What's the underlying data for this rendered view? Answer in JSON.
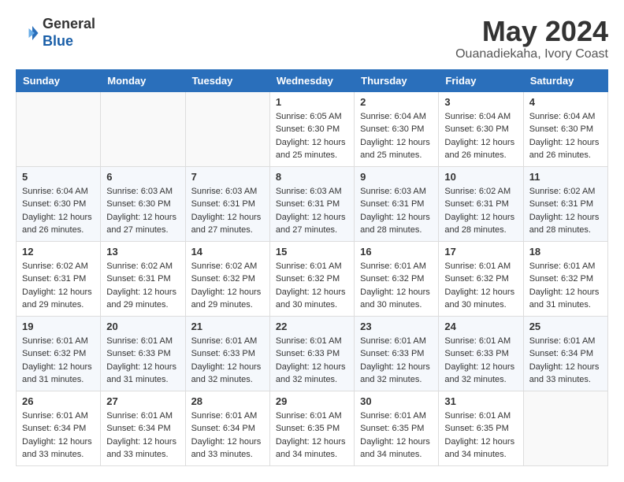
{
  "logo": {
    "line1": "General",
    "line2": "Blue"
  },
  "title": {
    "month_year": "May 2024",
    "location": "Ouanadiekaha, Ivory Coast"
  },
  "headers": [
    "Sunday",
    "Monday",
    "Tuesday",
    "Wednesday",
    "Thursday",
    "Friday",
    "Saturday"
  ],
  "weeks": [
    [
      {
        "day": "",
        "sunrise": "",
        "sunset": "",
        "daylight": ""
      },
      {
        "day": "",
        "sunrise": "",
        "sunset": "",
        "daylight": ""
      },
      {
        "day": "",
        "sunrise": "",
        "sunset": "",
        "daylight": ""
      },
      {
        "day": "1",
        "sunrise": "Sunrise: 6:05 AM",
        "sunset": "Sunset: 6:30 PM",
        "daylight": "Daylight: 12 hours and 25 minutes."
      },
      {
        "day": "2",
        "sunrise": "Sunrise: 6:04 AM",
        "sunset": "Sunset: 6:30 PM",
        "daylight": "Daylight: 12 hours and 25 minutes."
      },
      {
        "day": "3",
        "sunrise": "Sunrise: 6:04 AM",
        "sunset": "Sunset: 6:30 PM",
        "daylight": "Daylight: 12 hours and 26 minutes."
      },
      {
        "day": "4",
        "sunrise": "Sunrise: 6:04 AM",
        "sunset": "Sunset: 6:30 PM",
        "daylight": "Daylight: 12 hours and 26 minutes."
      }
    ],
    [
      {
        "day": "5",
        "sunrise": "Sunrise: 6:04 AM",
        "sunset": "Sunset: 6:30 PM",
        "daylight": "Daylight: 12 hours and 26 minutes."
      },
      {
        "day": "6",
        "sunrise": "Sunrise: 6:03 AM",
        "sunset": "Sunset: 6:30 PM",
        "daylight": "Daylight: 12 hours and 27 minutes."
      },
      {
        "day": "7",
        "sunrise": "Sunrise: 6:03 AM",
        "sunset": "Sunset: 6:31 PM",
        "daylight": "Daylight: 12 hours and 27 minutes."
      },
      {
        "day": "8",
        "sunrise": "Sunrise: 6:03 AM",
        "sunset": "Sunset: 6:31 PM",
        "daylight": "Daylight: 12 hours and 27 minutes."
      },
      {
        "day": "9",
        "sunrise": "Sunrise: 6:03 AM",
        "sunset": "Sunset: 6:31 PM",
        "daylight": "Daylight: 12 hours and 28 minutes."
      },
      {
        "day": "10",
        "sunrise": "Sunrise: 6:02 AM",
        "sunset": "Sunset: 6:31 PM",
        "daylight": "Daylight: 12 hours and 28 minutes."
      },
      {
        "day": "11",
        "sunrise": "Sunrise: 6:02 AM",
        "sunset": "Sunset: 6:31 PM",
        "daylight": "Daylight: 12 hours and 28 minutes."
      }
    ],
    [
      {
        "day": "12",
        "sunrise": "Sunrise: 6:02 AM",
        "sunset": "Sunset: 6:31 PM",
        "daylight": "Daylight: 12 hours and 29 minutes."
      },
      {
        "day": "13",
        "sunrise": "Sunrise: 6:02 AM",
        "sunset": "Sunset: 6:31 PM",
        "daylight": "Daylight: 12 hours and 29 minutes."
      },
      {
        "day": "14",
        "sunrise": "Sunrise: 6:02 AM",
        "sunset": "Sunset: 6:32 PM",
        "daylight": "Daylight: 12 hours and 29 minutes."
      },
      {
        "day": "15",
        "sunrise": "Sunrise: 6:01 AM",
        "sunset": "Sunset: 6:32 PM",
        "daylight": "Daylight: 12 hours and 30 minutes."
      },
      {
        "day": "16",
        "sunrise": "Sunrise: 6:01 AM",
        "sunset": "Sunset: 6:32 PM",
        "daylight": "Daylight: 12 hours and 30 minutes."
      },
      {
        "day": "17",
        "sunrise": "Sunrise: 6:01 AM",
        "sunset": "Sunset: 6:32 PM",
        "daylight": "Daylight: 12 hours and 30 minutes."
      },
      {
        "day": "18",
        "sunrise": "Sunrise: 6:01 AM",
        "sunset": "Sunset: 6:32 PM",
        "daylight": "Daylight: 12 hours and 31 minutes."
      }
    ],
    [
      {
        "day": "19",
        "sunrise": "Sunrise: 6:01 AM",
        "sunset": "Sunset: 6:32 PM",
        "daylight": "Daylight: 12 hours and 31 minutes."
      },
      {
        "day": "20",
        "sunrise": "Sunrise: 6:01 AM",
        "sunset": "Sunset: 6:33 PM",
        "daylight": "Daylight: 12 hours and 31 minutes."
      },
      {
        "day": "21",
        "sunrise": "Sunrise: 6:01 AM",
        "sunset": "Sunset: 6:33 PM",
        "daylight": "Daylight: 12 hours and 32 minutes."
      },
      {
        "day": "22",
        "sunrise": "Sunrise: 6:01 AM",
        "sunset": "Sunset: 6:33 PM",
        "daylight": "Daylight: 12 hours and 32 minutes."
      },
      {
        "day": "23",
        "sunrise": "Sunrise: 6:01 AM",
        "sunset": "Sunset: 6:33 PM",
        "daylight": "Daylight: 12 hours and 32 minutes."
      },
      {
        "day": "24",
        "sunrise": "Sunrise: 6:01 AM",
        "sunset": "Sunset: 6:33 PM",
        "daylight": "Daylight: 12 hours and 32 minutes."
      },
      {
        "day": "25",
        "sunrise": "Sunrise: 6:01 AM",
        "sunset": "Sunset: 6:34 PM",
        "daylight": "Daylight: 12 hours and 33 minutes."
      }
    ],
    [
      {
        "day": "26",
        "sunrise": "Sunrise: 6:01 AM",
        "sunset": "Sunset: 6:34 PM",
        "daylight": "Daylight: 12 hours and 33 minutes."
      },
      {
        "day": "27",
        "sunrise": "Sunrise: 6:01 AM",
        "sunset": "Sunset: 6:34 PM",
        "daylight": "Daylight: 12 hours and 33 minutes."
      },
      {
        "day": "28",
        "sunrise": "Sunrise: 6:01 AM",
        "sunset": "Sunset: 6:34 PM",
        "daylight": "Daylight: 12 hours and 33 minutes."
      },
      {
        "day": "29",
        "sunrise": "Sunrise: 6:01 AM",
        "sunset": "Sunset: 6:35 PM",
        "daylight": "Daylight: 12 hours and 34 minutes."
      },
      {
        "day": "30",
        "sunrise": "Sunrise: 6:01 AM",
        "sunset": "Sunset: 6:35 PM",
        "daylight": "Daylight: 12 hours and 34 minutes."
      },
      {
        "day": "31",
        "sunrise": "Sunrise: 6:01 AM",
        "sunset": "Sunset: 6:35 PM",
        "daylight": "Daylight: 12 hours and 34 minutes."
      },
      {
        "day": "",
        "sunrise": "",
        "sunset": "",
        "daylight": ""
      }
    ]
  ]
}
